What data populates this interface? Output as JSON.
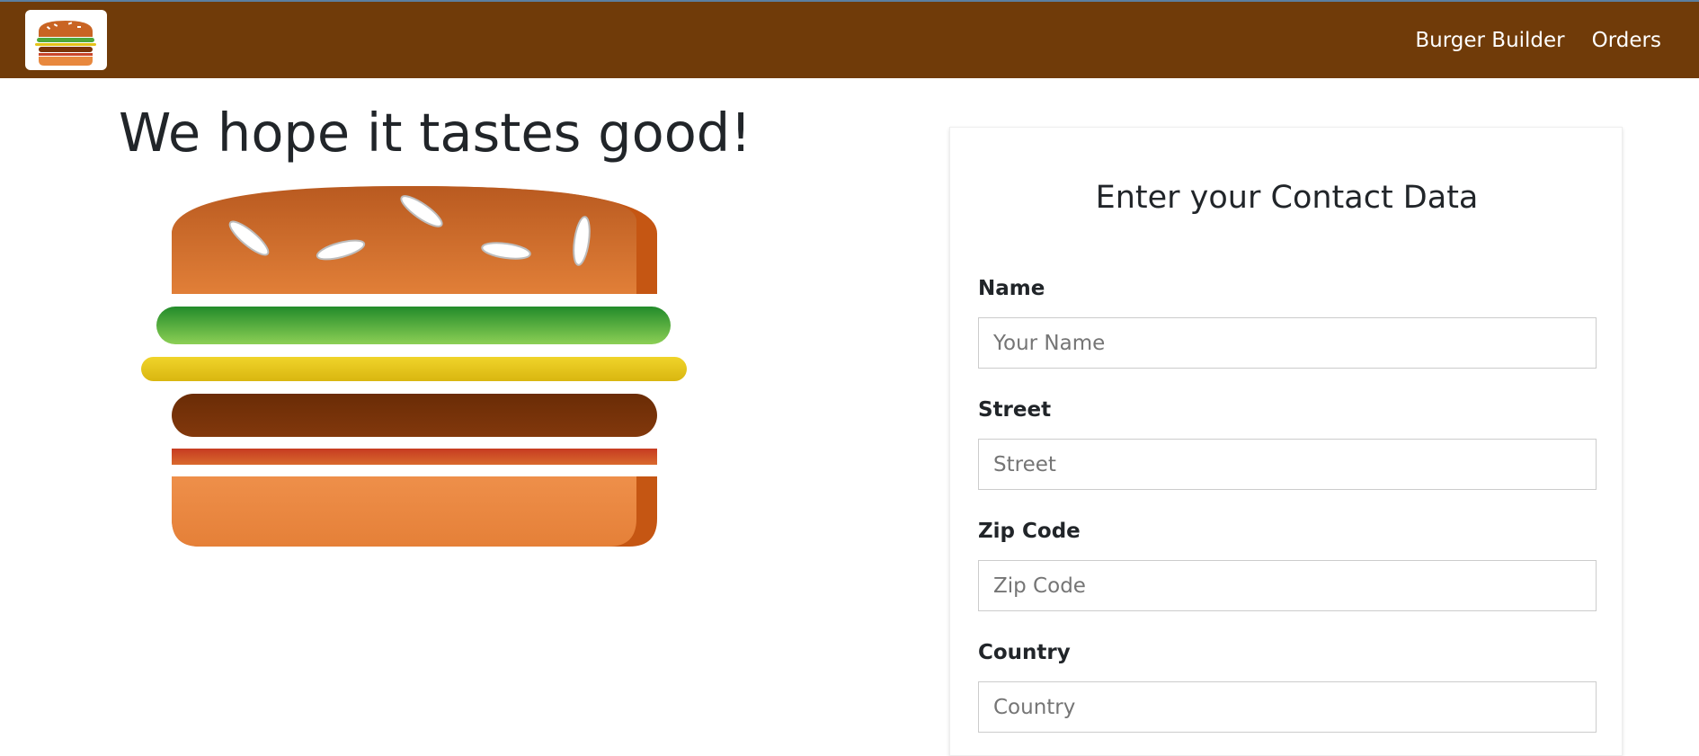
{
  "header": {
    "logo_icon": "burger-logo-icon",
    "nav": [
      {
        "label": "Burger Builder"
      },
      {
        "label": "Orders"
      }
    ],
    "background": "#703b09"
  },
  "main": {
    "title": "We hope it tastes good!",
    "burger_icon": "burger-illustration"
  },
  "contact_form": {
    "title": "Enter your Contact Data",
    "fields": [
      {
        "label": "Name",
        "placeholder": "Your Name",
        "value": ""
      },
      {
        "label": "Street",
        "placeholder": "Street",
        "value": ""
      },
      {
        "label": "Zip Code",
        "placeholder": "Zip Code",
        "value": ""
      },
      {
        "label": "Country",
        "placeholder": "Country",
        "value": ""
      }
    ]
  }
}
